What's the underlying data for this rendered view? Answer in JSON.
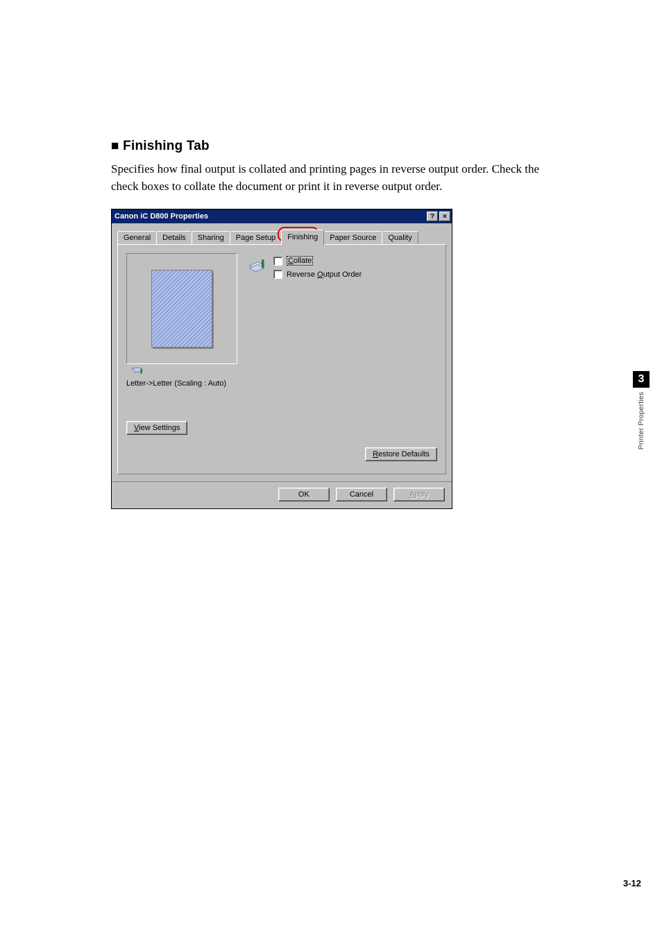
{
  "heading": "■ Finishing Tab",
  "paragraph": "Specifies how final output is collated and printing pages in reverse output order. Check the check boxes to collate the document or print it in reverse output order.",
  "sidebar": {
    "chapter": "3",
    "label": "Printer Properties"
  },
  "page_number": "3-12",
  "dialog": {
    "title": "Canon iC D800 Properties",
    "help_glyph": "?",
    "close_glyph": "×",
    "tabs": [
      "General",
      "Details",
      "Sharing",
      "Page Setup",
      "Finishing",
      "Paper Source",
      "Quality"
    ],
    "active_tab_index": 4,
    "preview_caption": "Letter->Letter (Scaling : Auto)",
    "checkboxes": {
      "collate": {
        "label_pre": "C",
        "label_rest": "ollate"
      },
      "reverse": {
        "label_pre": "Reverse ",
        "label_u": "O",
        "label_post": "utput Order"
      }
    },
    "buttons": {
      "view_settings_pre": "V",
      "view_settings_rest": "iew Settings",
      "restore_pre": "R",
      "restore_rest": "estore Defaults",
      "ok": "OK",
      "cancel": "Cancel",
      "apply_pre": "A",
      "apply_rest": "pply"
    }
  }
}
